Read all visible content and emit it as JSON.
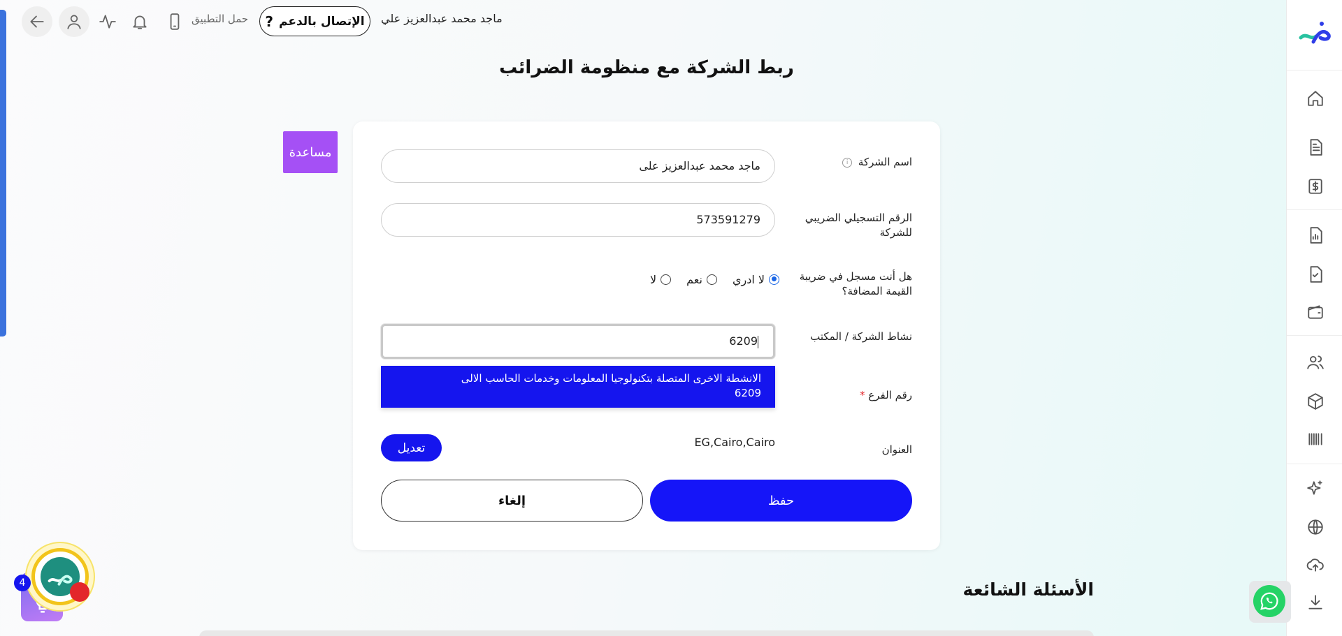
{
  "topbar": {
    "user_name": "ماجد محمد عبدالعزيز علي",
    "support_label": "الإتصال بالدعم",
    "support_icon": "?",
    "app_link": "حمل التطبيق",
    "icons": [
      "back-arrow-icon",
      "user-icon",
      "activity-icon",
      "bell-icon",
      "phone-icon"
    ]
  },
  "sidebar": {
    "icons": [
      "logo",
      "home-icon",
      "document-icon",
      "dollar-icon",
      "report-icon",
      "check-document-icon",
      "wallet-icon",
      "users-icon",
      "box-icon",
      "barcode-icon",
      "sparkle-icon",
      "globe-icon",
      "upload-icon",
      "download-icon"
    ]
  },
  "page": {
    "title": "ربط الشركة مع منظومة الضرائب",
    "help_label": "مساعدة"
  },
  "form": {
    "company_name_label": "اسم الشركة",
    "company_name_info": "i",
    "company_name_value": "ماجد محمد عبدالعزيز على",
    "tax_id_label": "الرقم التسجيلي الضريبي للشركة",
    "tax_id_value": "573591279",
    "vat_question_label": "هل أنت مسجل في ضريبة القيمة المضافة؟",
    "vat_options": [
      {
        "label": "لا ادري",
        "selected": true
      },
      {
        "label": "نعم",
        "selected": false
      },
      {
        "label": "لا",
        "selected": false
      }
    ],
    "activity_label": "نشاط الشركة / المكتب",
    "activity_value": "6209",
    "activity_suggestion_line1": "الانشطة الاخرى المتصلة بتكنولوجيا المعلومات وخدمات الحاسب الالى",
    "activity_suggestion_line2": "6209",
    "branch_label": "رقم الفرع",
    "branch_required_mark": "*",
    "address_label": "العنوان",
    "address_value": "EG,Cairo,Cairo",
    "edit_label": "تعديل",
    "save_label": "حفظ",
    "cancel_label": "إلغاء"
  },
  "faq": {
    "title": "الأسئلة الشائعة"
  },
  "assistant": {
    "badge_count": "4"
  },
  "colors": {
    "primary": "#1515f8",
    "help": "#a550f5",
    "accent_bar": "#3b72dd",
    "whatsapp": "#25d366"
  }
}
